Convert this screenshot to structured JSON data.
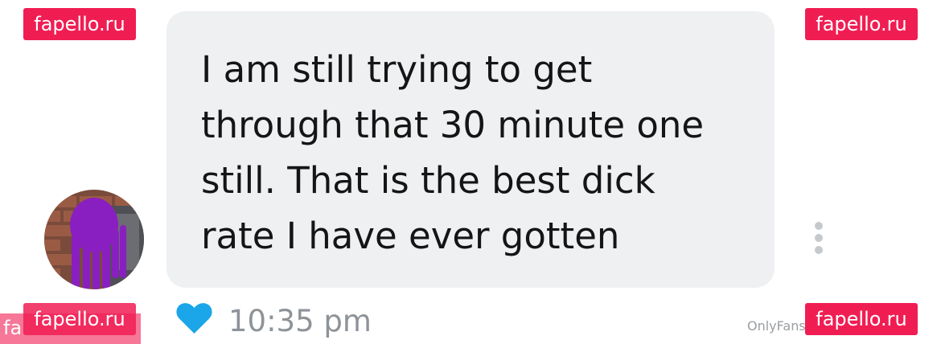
{
  "message": {
    "text": "I am still trying to get\nthrough that 30 minute one\nstill. That is the best dick\nrate I have ever gotten",
    "time": "10:35 pm",
    "reaction_icon": "heart-icon",
    "reaction_color": "#1aa6e8"
  },
  "watermarks": {
    "top_left": "fapello.ru",
    "top_right": "fapello.ru",
    "bottom_left": "fapello.ru",
    "bottom_right": "fapello.ru",
    "bottom_left_ghost": "fa"
  },
  "footer": {
    "credit": "OnlyFans"
  },
  "colors": {
    "bubble_bg": "#eef0f1",
    "watermark_bg": "#f01d53",
    "time_color": "#8e9398"
  },
  "icons": {
    "more": "more-vertical-icon",
    "avatar": "avatar"
  }
}
